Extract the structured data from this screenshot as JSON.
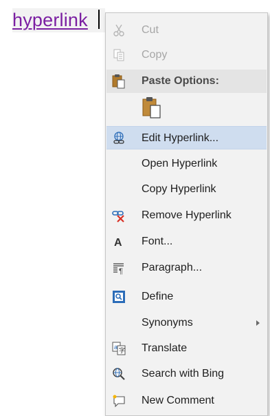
{
  "document": {
    "link_text": "hyperlink",
    "link_color": "#7b1fa2"
  },
  "context_menu": {
    "cut": {
      "label": "Cut",
      "icon": "scissors-icon",
      "disabled": true
    },
    "copy": {
      "label": "Copy",
      "icon": "copy-icon",
      "disabled": true
    },
    "paste_options": {
      "label": "Paste Options:",
      "icon": "clipboard-icon"
    },
    "paste_keep_text": {
      "icon": "paste-keep-text-only-icon"
    },
    "edit_hyperlink": {
      "label": "Edit Hyperlink...",
      "icon": "edit-hyperlink-icon",
      "highlighted": true
    },
    "open_hyperlink": {
      "label": "Open Hyperlink"
    },
    "copy_hyperlink": {
      "label": "Copy Hyperlink"
    },
    "remove_hyperlink": {
      "label": "Remove Hyperlink",
      "icon": "remove-hyperlink-icon"
    },
    "font": {
      "label": "Font...",
      "icon": "font-icon"
    },
    "paragraph": {
      "label": "Paragraph...",
      "icon": "paragraph-icon"
    },
    "define": {
      "label": "Define",
      "icon": "define-icon"
    },
    "synonyms": {
      "label": "Synonyms",
      "has_submenu": true
    },
    "translate": {
      "label": "Translate",
      "icon": "translate-icon"
    },
    "search_bing": {
      "label": "Search with Bing",
      "icon": "search-bing-icon"
    },
    "new_comment": {
      "label": "New Comment",
      "icon": "new-comment-icon"
    }
  },
  "colors": {
    "menu_bg": "#f2f2f2",
    "highlight_bg": "#cfddef",
    "disabled_text": "#a6a6a6",
    "accent_blue": "#2b6cb8",
    "remove_red": "#d93025"
  }
}
